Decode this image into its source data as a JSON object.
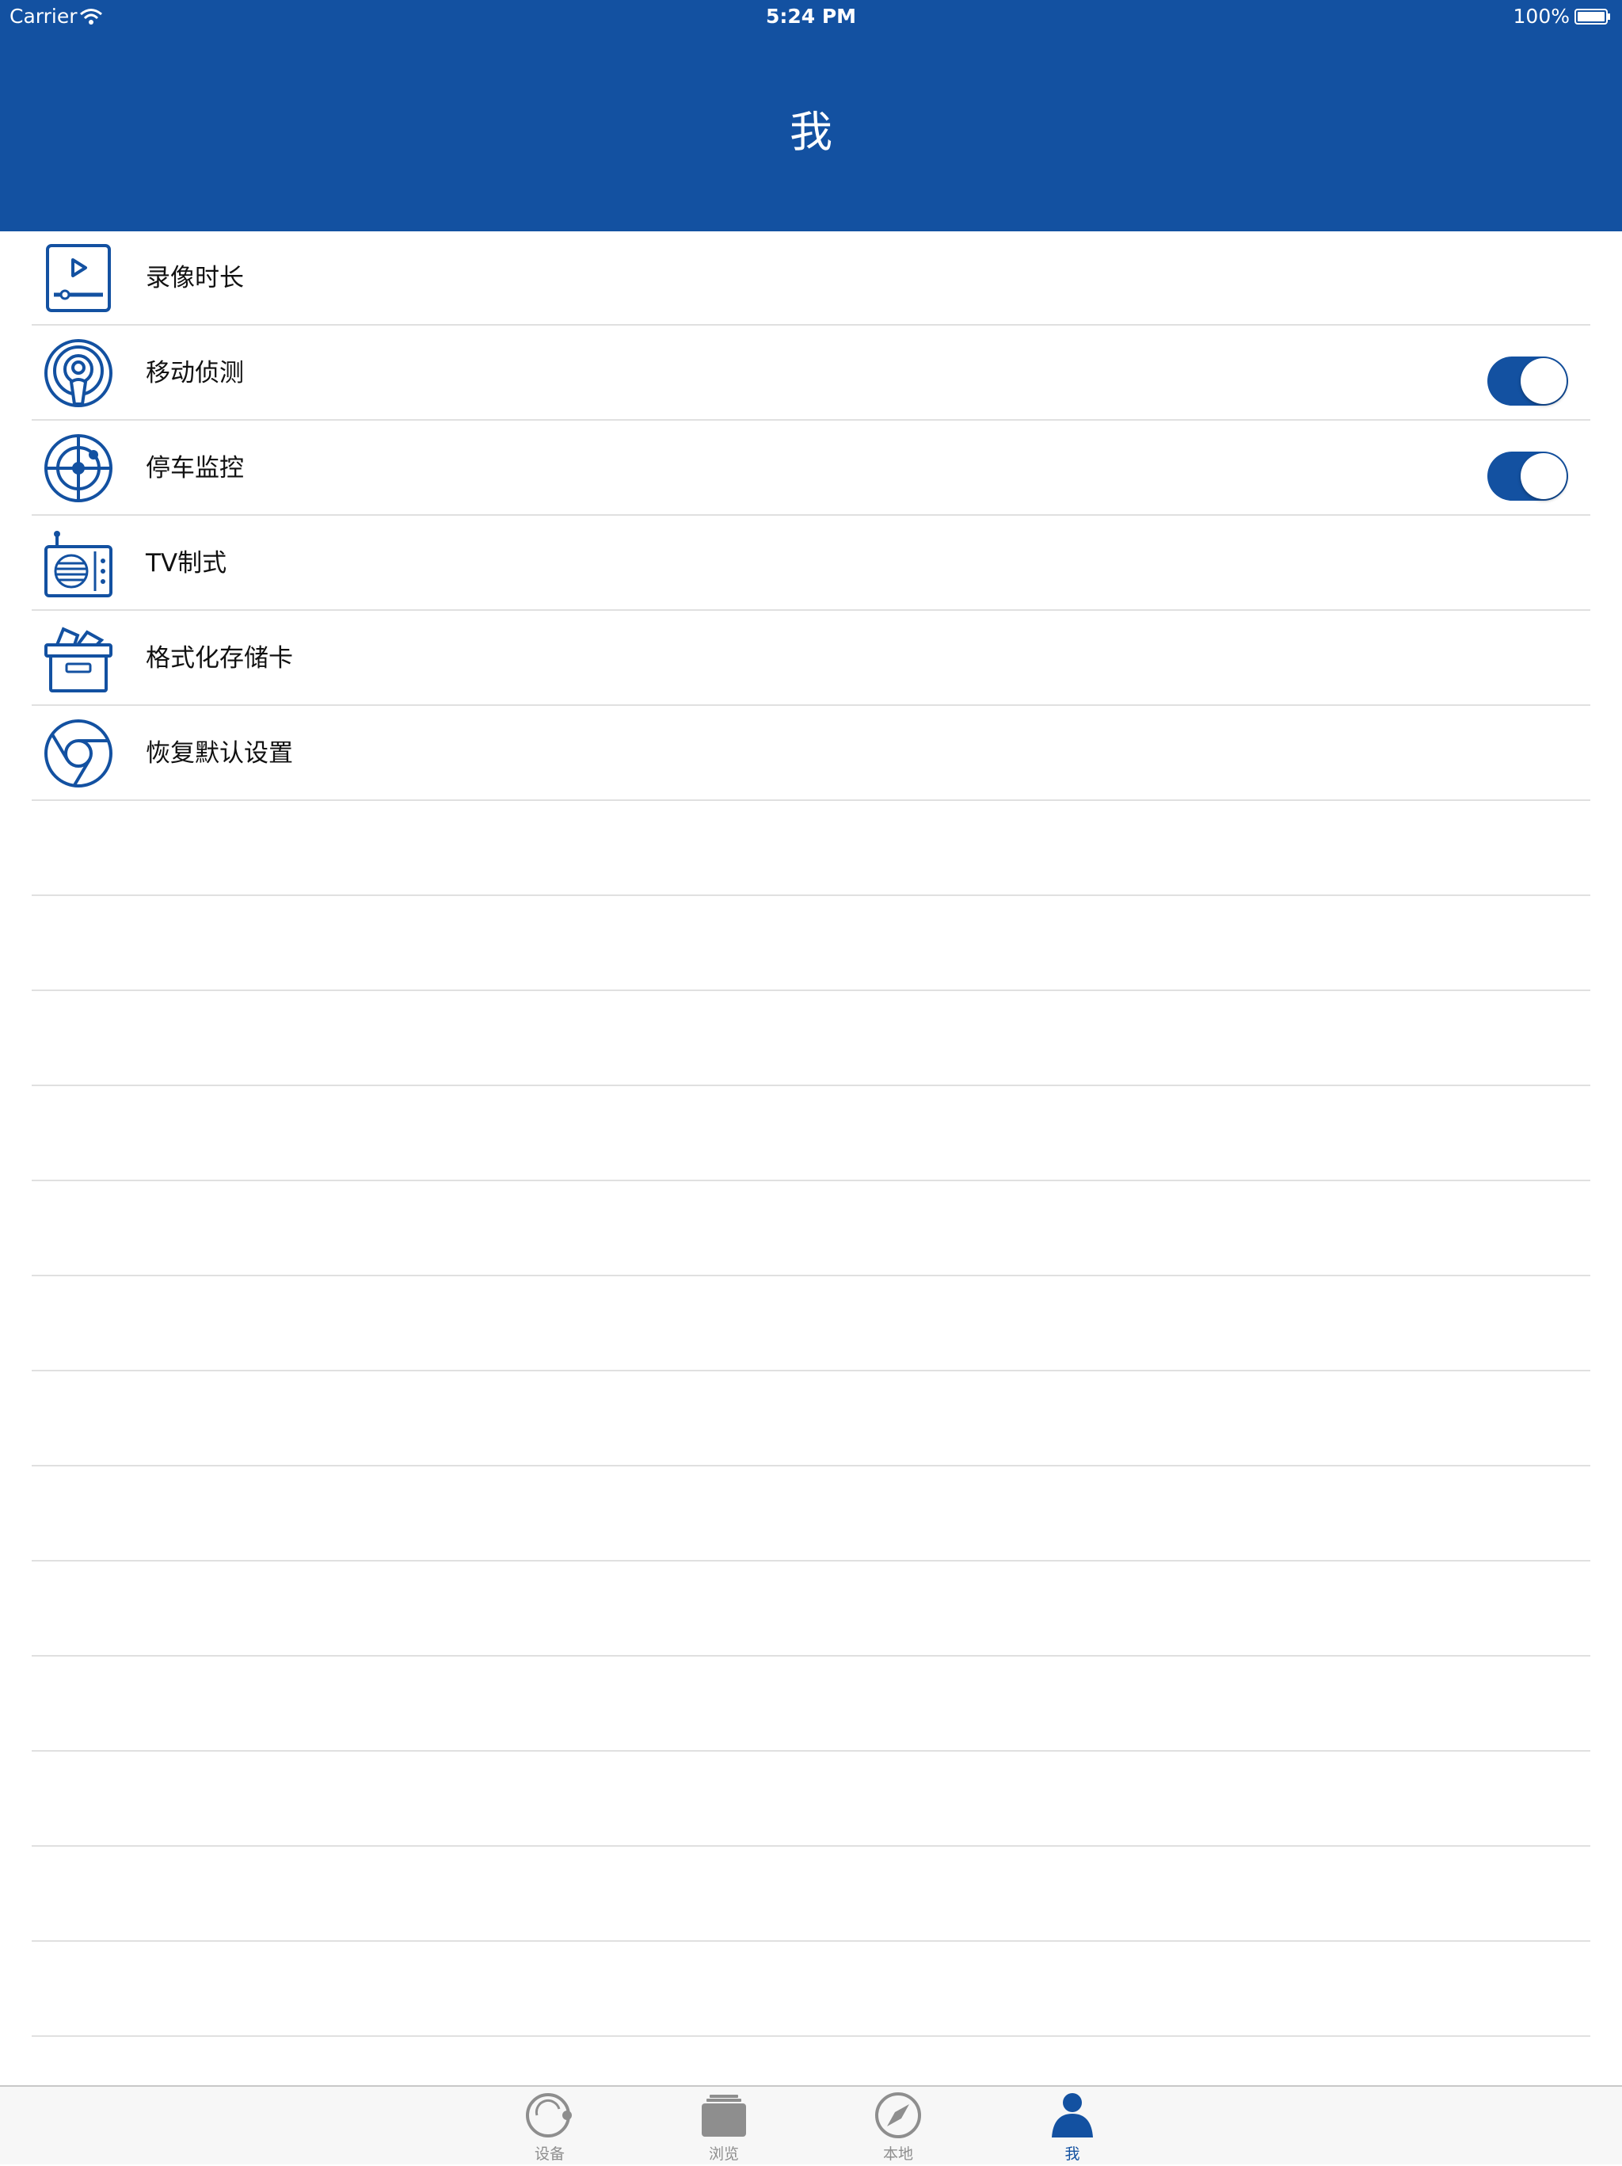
{
  "status_bar": {
    "carrier": "Carrier",
    "time": "5:24 PM",
    "battery": "100%"
  },
  "header": {
    "title": "我"
  },
  "colors": {
    "accent": "#1351a1",
    "divider": "#e0e0e0",
    "tab_inactive": "#8e8e8e"
  },
  "settings": {
    "items": [
      {
        "label": "录像时长",
        "icon": "video-play-icon"
      },
      {
        "label": "移动侦测",
        "icon": "motion-sensor-icon",
        "toggle": true
      },
      {
        "label": "停车监控",
        "icon": "radar-target-icon",
        "toggle": true
      },
      {
        "label": "TV制式",
        "icon": "tv-radio-icon"
      },
      {
        "label": "格式化存储卡",
        "icon": "storage-box-icon"
      },
      {
        "label": "恢复默认设置",
        "icon": "reset-chrome-icon"
      }
    ]
  },
  "tabbar": {
    "tabs": [
      {
        "label": "设备",
        "icon": "device-icon"
      },
      {
        "label": "浏览",
        "icon": "browse-icon"
      },
      {
        "label": "本地",
        "icon": "compass-icon"
      },
      {
        "label": "我",
        "icon": "person-icon",
        "active": true
      }
    ]
  }
}
